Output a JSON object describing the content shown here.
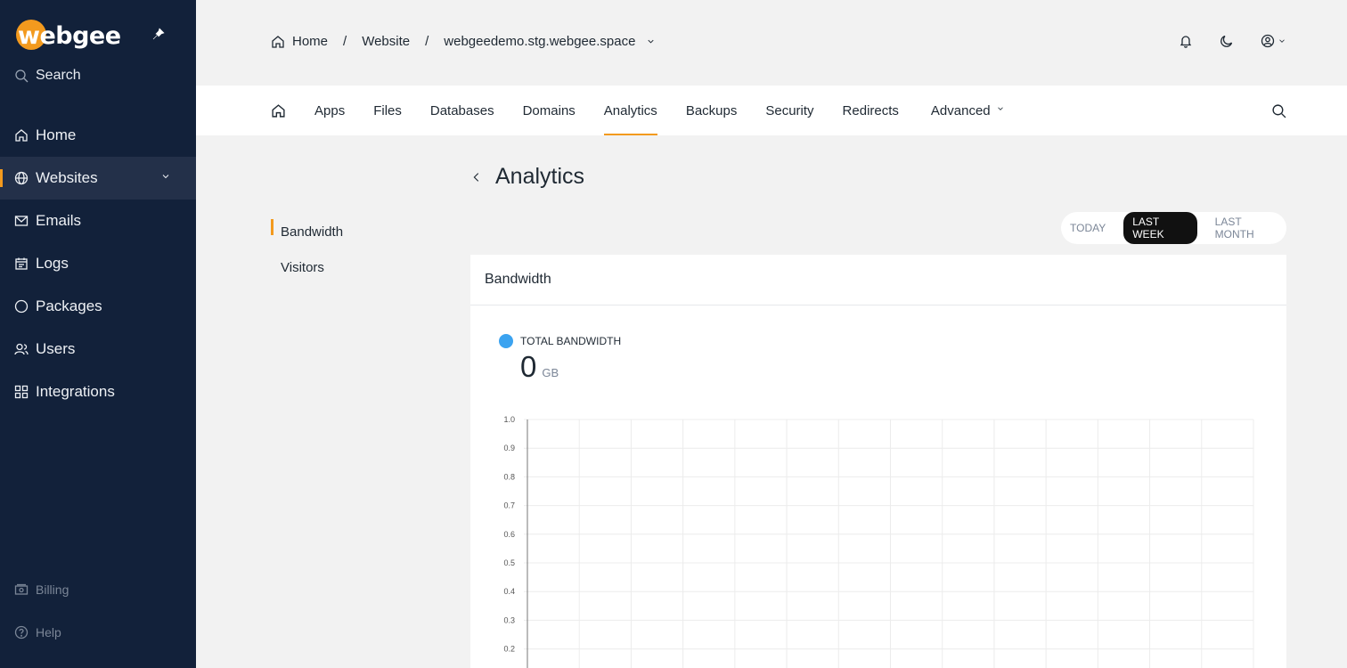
{
  "brand": {
    "logo_text": "webgee",
    "accent": "#f39a1e",
    "sidebar_bg": "#12213a"
  },
  "sidebar": {
    "search_label": "Search",
    "items": [
      {
        "label": "Home",
        "icon": "home-icon"
      },
      {
        "label": "Websites",
        "icon": "globe-icon",
        "active": true
      },
      {
        "label": "Emails",
        "icon": "mail-icon"
      },
      {
        "label": "Logs",
        "icon": "calendar-icon"
      },
      {
        "label": "Packages",
        "icon": "circle-icon"
      },
      {
        "label": "Users",
        "icon": "users-icon"
      },
      {
        "label": "Integrations",
        "icon": "grid-icon"
      }
    ],
    "bottom": [
      {
        "label": "Billing",
        "icon": "billing-icon"
      },
      {
        "label": "Help",
        "icon": "help-icon"
      }
    ]
  },
  "breadcrumb": {
    "home": "Home",
    "website": "Website",
    "site": "webgeedemo.stg.webgee.space",
    "separator": "/"
  },
  "tabs": [
    "Apps",
    "Files",
    "Databases",
    "Domains",
    "Analytics",
    "Backups",
    "Security",
    "Redirects",
    "Advanced"
  ],
  "active_tab": "Analytics",
  "page": {
    "title": "Analytics"
  },
  "subnav": [
    "Bandwidth",
    "Visitors"
  ],
  "range": {
    "options": [
      "TODAY",
      "LAST WEEK",
      "LAST MONTH"
    ],
    "selected": "LAST WEEK"
  },
  "card": {
    "title": "Bandwidth",
    "legend": "TOTAL BANDWIDTH",
    "legend_color": "#3ba3f0",
    "total_value": "0",
    "total_unit": "GB"
  },
  "chart_data": {
    "type": "line",
    "title": "",
    "xlabel": "",
    "ylabel": "",
    "ylim": [
      0,
      1.0
    ],
    "y_ticks": [
      "1.0",
      "0.9",
      "0.8",
      "0.7",
      "0.6",
      "0.5",
      "0.4",
      "0.3",
      "0.2"
    ],
    "grid": true,
    "series": []
  }
}
